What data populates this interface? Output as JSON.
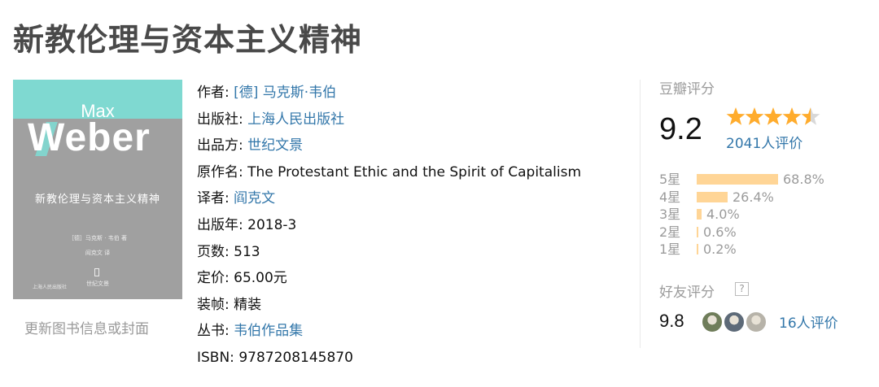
{
  "book": {
    "title": "新教伦理与资本主义精神",
    "cover": {
      "author_first": "Max",
      "author_last": "Weber",
      "title_cn": "新教伦理与资本主义精神",
      "byline": "［德］马克斯 · 韦伯 著",
      "translator": "阎克文 译",
      "publisher_small": "上海人民出版社",
      "imprint_small": "世纪文景",
      "teal_color": "#7fd9d1",
      "gray_color": "#a0a0a0"
    },
    "update_link": "更新图书信息或封面"
  },
  "info": {
    "author": {
      "label": "作者: ",
      "value": "[德] 马克斯·韦伯"
    },
    "publisher": {
      "label": "出版社: ",
      "value": "上海人民出版社"
    },
    "producer": {
      "label": "出品方: ",
      "value": "世纪文景"
    },
    "original_title": {
      "label": "原作名: ",
      "value": "The Protestant Ethic and the Spirit of Capitalism"
    },
    "translator": {
      "label": "译者: ",
      "value": "阎克文"
    },
    "pub_year": {
      "label": "出版年: ",
      "value": "2018-3"
    },
    "pages": {
      "label": "页数: ",
      "value": "513"
    },
    "price": {
      "label": "定价: ",
      "value": "65.00元"
    },
    "binding": {
      "label": "装帧: ",
      "value": "精装"
    },
    "series": {
      "label": "丛书: ",
      "value": "韦伯作品集"
    },
    "isbn": {
      "label": "ISBN: ",
      "value": "9787208145870"
    }
  },
  "rating": {
    "title": "豆瓣评分",
    "score": "9.2",
    "stars": 4.5,
    "votes": "2041人评价",
    "distribution": [
      {
        "label": "5星",
        "percent": 68.8,
        "text": "68.8%"
      },
      {
        "label": "4星",
        "percent": 26.4,
        "text": "26.4%"
      },
      {
        "label": "3星",
        "percent": 4.0,
        "text": "4.0%"
      },
      {
        "label": "2星",
        "percent": 0.6,
        "text": "0.6%"
      },
      {
        "label": "1星",
        "percent": 0.2,
        "text": "0.2%"
      }
    ],
    "bar_color": "#ffd596",
    "star_color": "#ffac2d"
  },
  "friends": {
    "title": "好友评分",
    "help": "?",
    "score": "9.8",
    "votes": "16人评价",
    "avatar_colors": [
      "#6f7d5a",
      "#5d6a78",
      "#b7b3a9"
    ]
  },
  "colors": {
    "link": "#37a",
    "muted": "#9b9b9b",
    "title": "#494949"
  }
}
